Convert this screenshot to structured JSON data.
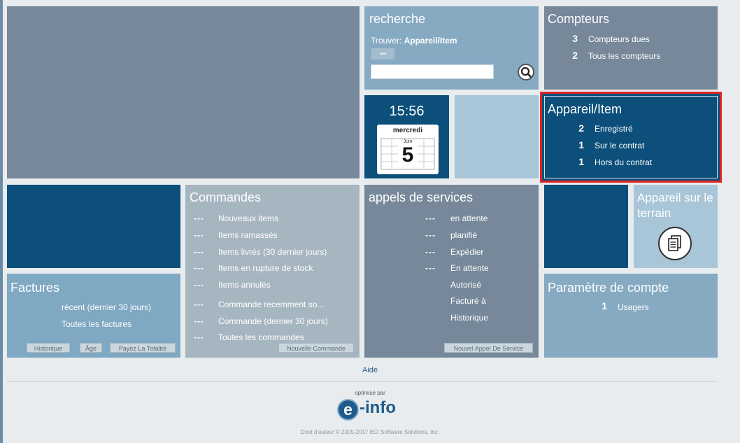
{
  "search": {
    "title": "recherche",
    "find_prefix": "Trouver: ",
    "find_value": "Appareil/Item",
    "options_label": "•••",
    "input_value": "",
    "input_placeholder": ""
  },
  "clock": {
    "time": "15:56",
    "day": "mercredi",
    "month": "Juin",
    "date": "5"
  },
  "counters": {
    "title": "Compteurs",
    "items": [
      {
        "count": "3",
        "label": "Compteurs dues"
      },
      {
        "count": "2",
        "label": "Tous les compteurs"
      }
    ]
  },
  "equipment": {
    "title": "Appareil/Item",
    "items": [
      {
        "count": "2",
        "label": "Enregistré"
      },
      {
        "count": "1",
        "label": "Sur le contrat"
      },
      {
        "count": "1",
        "label": "Hors du contrat"
      }
    ]
  },
  "orders": {
    "title": "Commandes",
    "items": [
      {
        "count": "---",
        "label": "Nouveaux items"
      },
      {
        "count": "---",
        "label": "Items ramassés"
      },
      {
        "count": "---",
        "label": "Items livrés (30 dernier jours)"
      },
      {
        "count": "---",
        "label": "Items en rupture de stock"
      },
      {
        "count": "---",
        "label": "Items annulés"
      },
      {
        "count": "---",
        "label": "Commande recemment so..."
      },
      {
        "count": "---",
        "label": "Commande (dernier 30 jours)"
      },
      {
        "count": "---",
        "label": "Toutes les commandes"
      }
    ],
    "new_button": "Nouvelle Commande"
  },
  "service_calls": {
    "title": "appels de services",
    "items": [
      {
        "count": "---",
        "label": "en attente"
      },
      {
        "count": "---",
        "label": "planifié"
      },
      {
        "count": "---",
        "label": "Expédier"
      },
      {
        "count": "---",
        "label": "En attente"
      },
      {
        "count": "",
        "label": "Autorisé"
      },
      {
        "count": "",
        "label": "Facturé à"
      },
      {
        "count": "",
        "label": "Historique"
      }
    ],
    "new_button": "Nouvel Appel De Service"
  },
  "invoices": {
    "title": "Factures",
    "items": [
      {
        "label": "récent (dernier 30 jours)"
      },
      {
        "label": "Toutes les factures"
      }
    ],
    "buttons": [
      "Historique",
      "Âge",
      "Payez La Totalité"
    ]
  },
  "field_equipment": {
    "title": "Appareil sur le terrain"
  },
  "account": {
    "title": "Paramètre de compte",
    "items": [
      {
        "count": "1",
        "label": "Usagers"
      }
    ]
  },
  "footer": {
    "help": "Aide",
    "optimized_by": "optimisé par",
    "logo_e": "e",
    "logo_text": "-info",
    "copyright": "Droit d'auteur © 2005-2017 ECI Software Solutions, Inc."
  },
  "colors": {
    "navy": "#0b4f7a",
    "slate": "#76889a",
    "highlight_border": "#e02424"
  }
}
